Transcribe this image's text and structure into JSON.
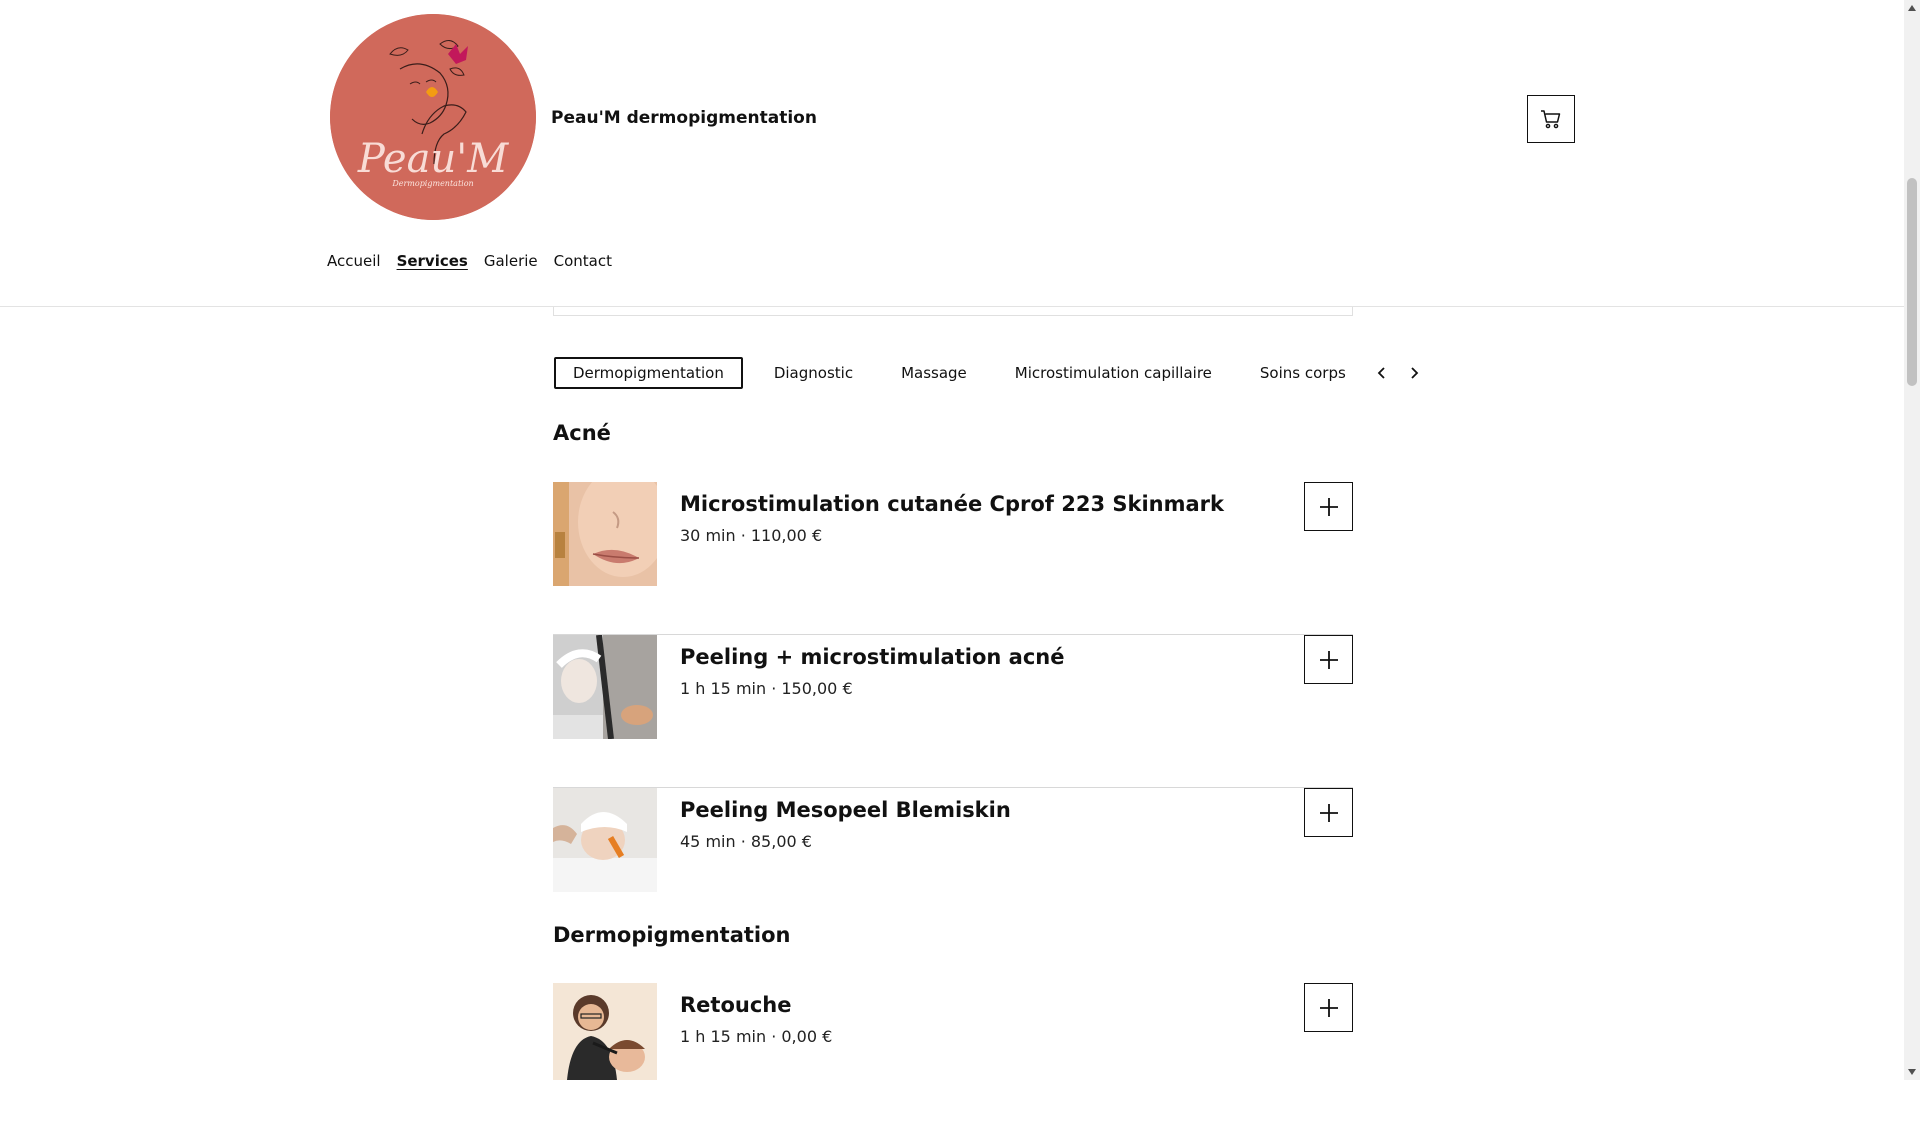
{
  "brand": {
    "name": "Peau'M dermopigmentation"
  },
  "nav": {
    "items": [
      "Accueil",
      "Services",
      "Galerie",
      "Contact"
    ],
    "active": "Services"
  },
  "tabs": {
    "items": [
      "Dermopigmentation",
      "Diagnostic",
      "Massage",
      "Microstimulation capillaire",
      "Soins corps"
    ],
    "active": "Dermopigmentation"
  },
  "sections": [
    {
      "title": "Acné",
      "services": [
        {
          "name": "Microstimulation cutanée Cprof 223 Skinmark",
          "meta": "30 min · 110,00 €"
        },
        {
          "name": "Peeling + microstimulation acné",
          "meta": "1 h 15 min · 150,00 €"
        },
        {
          "name": "Peeling Mesopeel Blemiskin",
          "meta": "45 min · 85,00 €"
        }
      ]
    },
    {
      "title": "Dermopigmentation",
      "services": [
        {
          "name": "Retouche",
          "meta": "1 h 15 min · 0,00 €"
        }
      ]
    }
  ],
  "icons": {
    "cart": "shopping-cart-icon",
    "add": "plus-icon",
    "tab_prev": "chevron-left-icon",
    "tab_next": "chevron-right-icon"
  },
  "colors": {
    "logo_bg": "#d0695b",
    "text": "#111111",
    "divider": "#d8d8d8"
  }
}
